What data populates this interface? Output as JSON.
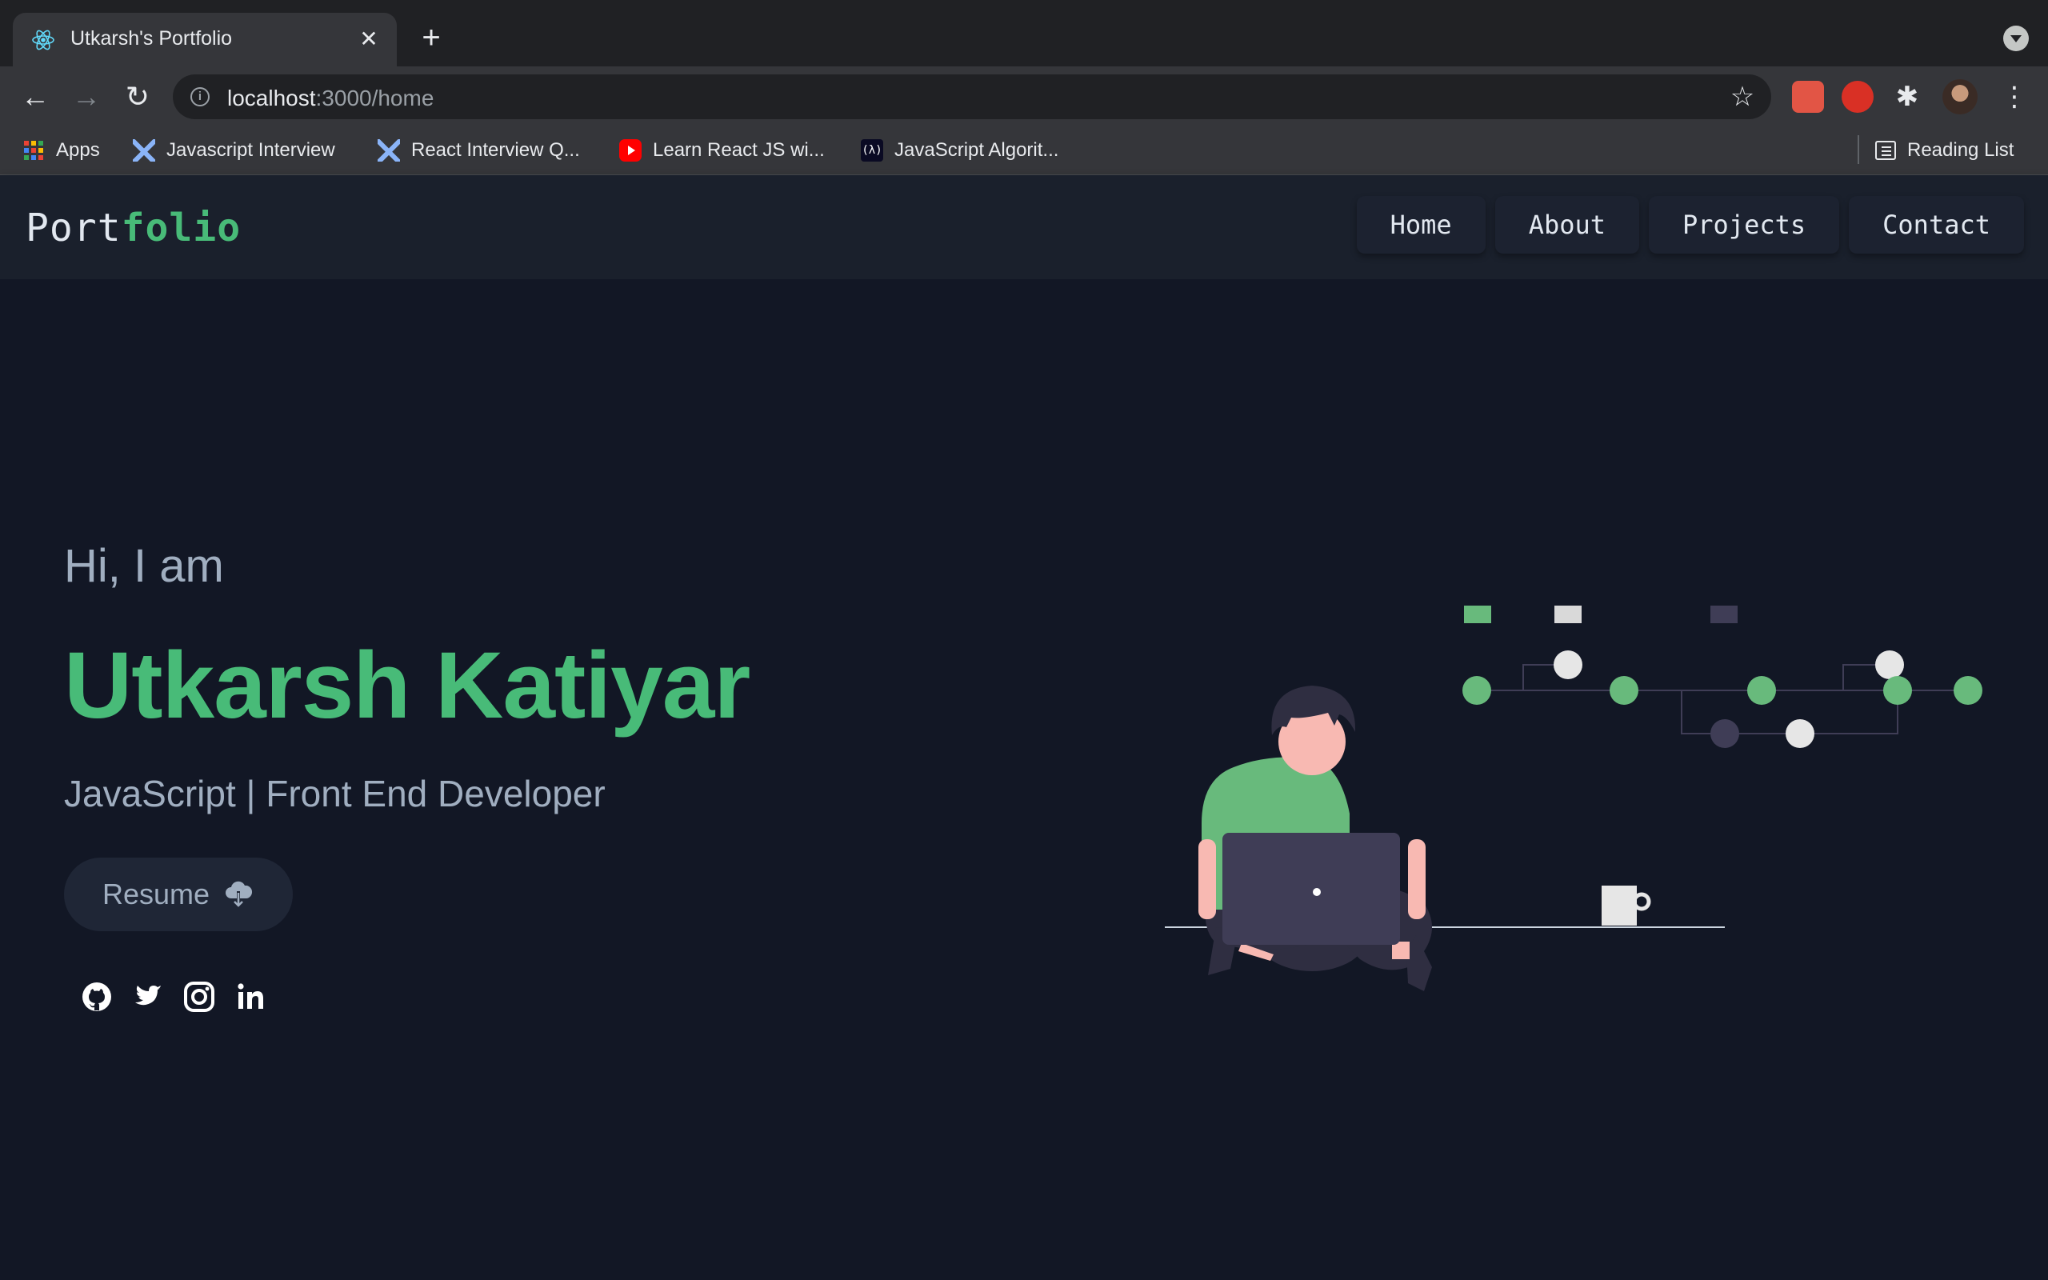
{
  "browser": {
    "tab_title": "Utkarsh's Portfolio",
    "url_host": "localhost",
    "url_rest": ":3000/home",
    "bookmarks": [
      {
        "label": "Apps",
        "icon": "apps-grid-icon"
      },
      {
        "label": "Javascript Interview",
        "icon": "mountain-icon"
      },
      {
        "label": "React Interview Q...",
        "icon": "mountain-icon"
      },
      {
        "label": "Learn React JS wi...",
        "icon": "youtube-icon"
      },
      {
        "label": "JavaScript Algorit...",
        "icon": "freecodecamp-icon"
      }
    ],
    "reading_list": "Reading List"
  },
  "site": {
    "logo_main": "Port",
    "logo_accent": "folio",
    "nav": [
      "Home",
      "About",
      "Projects",
      "Contact"
    ],
    "hero": {
      "greeting": "Hi, I am",
      "name": "Utkarsh Katiyar",
      "role": "JavaScript | Front End Developer",
      "resume_label": "Resume",
      "socials": [
        "github-icon",
        "twitter-icon",
        "instagram-icon",
        "linkedin-icon"
      ]
    }
  },
  "colors": {
    "accent": "#48bb78",
    "background": "#121725",
    "nav_background": "#1a202c",
    "text_muted": "#a0aec0"
  }
}
